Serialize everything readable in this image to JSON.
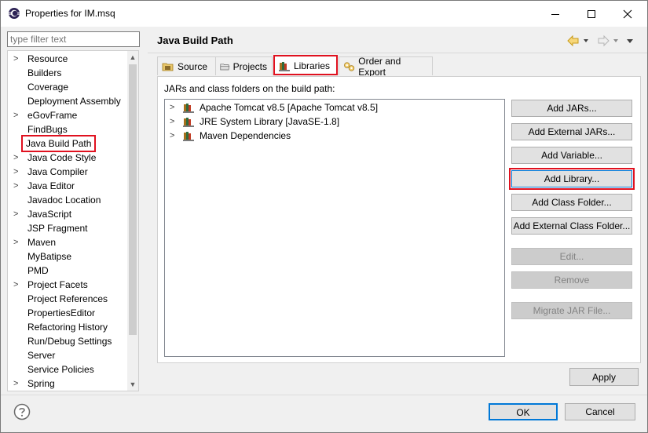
{
  "window": {
    "title": "Properties for IM.msq",
    "minimize_glyph": "—",
    "maximize_glyph": "☐",
    "close_glyph": "✕"
  },
  "filter": {
    "placeholder": "type filter text"
  },
  "tree": {
    "items": [
      {
        "label": "Resource",
        "expandable": true
      },
      {
        "label": "Builders",
        "expandable": false
      },
      {
        "label": "Coverage",
        "expandable": false
      },
      {
        "label": "Deployment Assembly",
        "expandable": false
      },
      {
        "label": "eGovFrame",
        "expandable": true
      },
      {
        "label": "FindBugs",
        "expandable": false
      },
      {
        "label": "Java Build Path",
        "expandable": false,
        "selected": true
      },
      {
        "label": "Java Code Style",
        "expandable": true
      },
      {
        "label": "Java Compiler",
        "expandable": true
      },
      {
        "label": "Java Editor",
        "expandable": true
      },
      {
        "label": "Javadoc Location",
        "expandable": false
      },
      {
        "label": "JavaScript",
        "expandable": true
      },
      {
        "label": "JSP Fragment",
        "expandable": false
      },
      {
        "label": "Maven",
        "expandable": true
      },
      {
        "label": "MyBatipse",
        "expandable": false
      },
      {
        "label": "PMD",
        "expandable": false
      },
      {
        "label": "Project Facets",
        "expandable": true
      },
      {
        "label": "Project References",
        "expandable": false
      },
      {
        "label": "PropertiesEditor",
        "expandable": false
      },
      {
        "label": "Refactoring History",
        "expandable": false
      },
      {
        "label": "Run/Debug Settings",
        "expandable": false
      },
      {
        "label": "Server",
        "expandable": false
      },
      {
        "label": "Service Policies",
        "expandable": false
      },
      {
        "label": "Spring",
        "expandable": true
      }
    ]
  },
  "page": {
    "title": "Java Build Path",
    "tabs": [
      {
        "label": "Source",
        "icon": "source-folder-icon"
      },
      {
        "label": "Projects",
        "icon": "projects-icon"
      },
      {
        "label": "Libraries",
        "icon": "libraries-icon",
        "active": true
      },
      {
        "label": "Order and Export",
        "icon": "order-export-icon"
      }
    ],
    "jar_label": "JARs and class folders on the build path:",
    "libraries": [
      {
        "label": "Apache Tomcat v8.5 [Apache Tomcat v8.5]"
      },
      {
        "label": "JRE System Library [JavaSE-1.8]"
      },
      {
        "label": "Maven Dependencies"
      }
    ],
    "buttons": {
      "add_jars": "Add JARs...",
      "add_external_jars": "Add External JARs...",
      "add_variable": "Add Variable...",
      "add_library": "Add Library...",
      "add_class_folder": "Add Class Folder...",
      "add_external_class_folder": "Add External Class Folder...",
      "edit": "Edit...",
      "remove": "Remove",
      "migrate_jar": "Migrate JAR File..."
    },
    "apply": "Apply"
  },
  "footer": {
    "ok": "OK",
    "cancel": "Cancel"
  },
  "colors": {
    "highlight": "#e0111f",
    "focus": "#0078d7"
  }
}
